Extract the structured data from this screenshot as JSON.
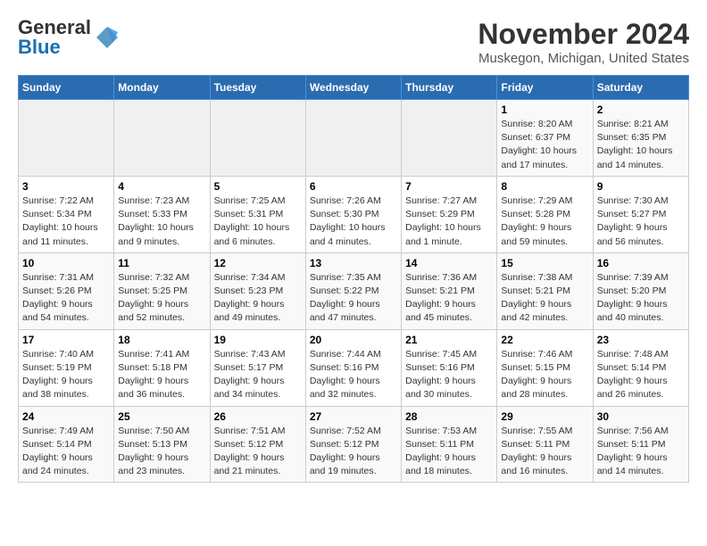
{
  "header": {
    "logo_line1": "General",
    "logo_line2": "Blue",
    "title": "November 2024",
    "subtitle": "Muskegon, Michigan, United States"
  },
  "weekdays": [
    "Sunday",
    "Monday",
    "Tuesday",
    "Wednesday",
    "Thursday",
    "Friday",
    "Saturday"
  ],
  "weeks": [
    [
      {
        "day": "",
        "info": ""
      },
      {
        "day": "",
        "info": ""
      },
      {
        "day": "",
        "info": ""
      },
      {
        "day": "",
        "info": ""
      },
      {
        "day": "",
        "info": ""
      },
      {
        "day": "1",
        "info": "Sunrise: 8:20 AM\nSunset: 6:37 PM\nDaylight: 10 hours\nand 17 minutes."
      },
      {
        "day": "2",
        "info": "Sunrise: 8:21 AM\nSunset: 6:35 PM\nDaylight: 10 hours\nand 14 minutes."
      }
    ],
    [
      {
        "day": "3",
        "info": "Sunrise: 7:22 AM\nSunset: 5:34 PM\nDaylight: 10 hours\nand 11 minutes."
      },
      {
        "day": "4",
        "info": "Sunrise: 7:23 AM\nSunset: 5:33 PM\nDaylight: 10 hours\nand 9 minutes."
      },
      {
        "day": "5",
        "info": "Sunrise: 7:25 AM\nSunset: 5:31 PM\nDaylight: 10 hours\nand 6 minutes."
      },
      {
        "day": "6",
        "info": "Sunrise: 7:26 AM\nSunset: 5:30 PM\nDaylight: 10 hours\nand 4 minutes."
      },
      {
        "day": "7",
        "info": "Sunrise: 7:27 AM\nSunset: 5:29 PM\nDaylight: 10 hours\nand 1 minute."
      },
      {
        "day": "8",
        "info": "Sunrise: 7:29 AM\nSunset: 5:28 PM\nDaylight: 9 hours\nand 59 minutes."
      },
      {
        "day": "9",
        "info": "Sunrise: 7:30 AM\nSunset: 5:27 PM\nDaylight: 9 hours\nand 56 minutes."
      }
    ],
    [
      {
        "day": "10",
        "info": "Sunrise: 7:31 AM\nSunset: 5:26 PM\nDaylight: 9 hours\nand 54 minutes."
      },
      {
        "day": "11",
        "info": "Sunrise: 7:32 AM\nSunset: 5:25 PM\nDaylight: 9 hours\nand 52 minutes."
      },
      {
        "day": "12",
        "info": "Sunrise: 7:34 AM\nSunset: 5:23 PM\nDaylight: 9 hours\nand 49 minutes."
      },
      {
        "day": "13",
        "info": "Sunrise: 7:35 AM\nSunset: 5:22 PM\nDaylight: 9 hours\nand 47 minutes."
      },
      {
        "day": "14",
        "info": "Sunrise: 7:36 AM\nSunset: 5:21 PM\nDaylight: 9 hours\nand 45 minutes."
      },
      {
        "day": "15",
        "info": "Sunrise: 7:38 AM\nSunset: 5:21 PM\nDaylight: 9 hours\nand 42 minutes."
      },
      {
        "day": "16",
        "info": "Sunrise: 7:39 AM\nSunset: 5:20 PM\nDaylight: 9 hours\nand 40 minutes."
      }
    ],
    [
      {
        "day": "17",
        "info": "Sunrise: 7:40 AM\nSunset: 5:19 PM\nDaylight: 9 hours\nand 38 minutes."
      },
      {
        "day": "18",
        "info": "Sunrise: 7:41 AM\nSunset: 5:18 PM\nDaylight: 9 hours\nand 36 minutes."
      },
      {
        "day": "19",
        "info": "Sunrise: 7:43 AM\nSunset: 5:17 PM\nDaylight: 9 hours\nand 34 minutes."
      },
      {
        "day": "20",
        "info": "Sunrise: 7:44 AM\nSunset: 5:16 PM\nDaylight: 9 hours\nand 32 minutes."
      },
      {
        "day": "21",
        "info": "Sunrise: 7:45 AM\nSunset: 5:16 PM\nDaylight: 9 hours\nand 30 minutes."
      },
      {
        "day": "22",
        "info": "Sunrise: 7:46 AM\nSunset: 5:15 PM\nDaylight: 9 hours\nand 28 minutes."
      },
      {
        "day": "23",
        "info": "Sunrise: 7:48 AM\nSunset: 5:14 PM\nDaylight: 9 hours\nand 26 minutes."
      }
    ],
    [
      {
        "day": "24",
        "info": "Sunrise: 7:49 AM\nSunset: 5:14 PM\nDaylight: 9 hours\nand 24 minutes."
      },
      {
        "day": "25",
        "info": "Sunrise: 7:50 AM\nSunset: 5:13 PM\nDaylight: 9 hours\nand 23 minutes."
      },
      {
        "day": "26",
        "info": "Sunrise: 7:51 AM\nSunset: 5:12 PM\nDaylight: 9 hours\nand 21 minutes."
      },
      {
        "day": "27",
        "info": "Sunrise: 7:52 AM\nSunset: 5:12 PM\nDaylight: 9 hours\nand 19 minutes."
      },
      {
        "day": "28",
        "info": "Sunrise: 7:53 AM\nSunset: 5:11 PM\nDaylight: 9 hours\nand 18 minutes."
      },
      {
        "day": "29",
        "info": "Sunrise: 7:55 AM\nSunset: 5:11 PM\nDaylight: 9 hours\nand 16 minutes."
      },
      {
        "day": "30",
        "info": "Sunrise: 7:56 AM\nSunset: 5:11 PM\nDaylight: 9 hours\nand 14 minutes."
      }
    ]
  ]
}
